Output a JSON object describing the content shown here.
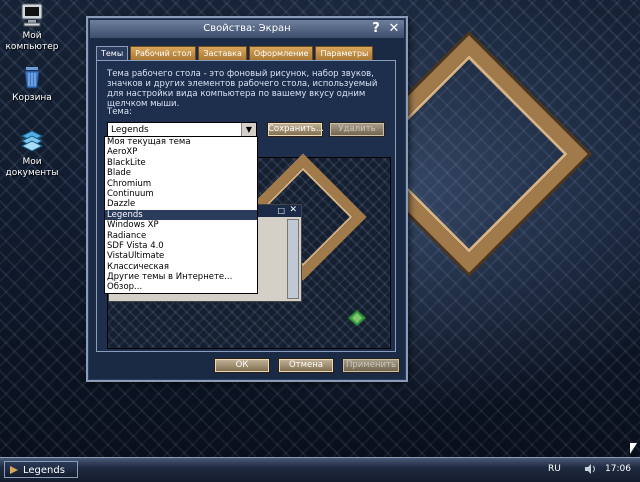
{
  "desktop": {
    "icons": [
      {
        "label": "Мой компьютер",
        "icon": "computer-icon"
      },
      {
        "label": "Корзина",
        "icon": "recycle-bin-icon"
      },
      {
        "label": "Мои документы",
        "icon": "documents-icon"
      }
    ]
  },
  "dialog": {
    "title": "Свойства: Экран",
    "help_glyph": "?",
    "close_glyph": "✕",
    "tabs": [
      "Темы",
      "Рабочий стол",
      "Заставка",
      "Оформление",
      "Параметры"
    ],
    "active_tab": 0,
    "description": "Тема рабочего стола - это фоновый рисунок, набор звуков, значков и других элементов рабочего стола, используемый для настройки вида компьютера по вашему вкусу одним щелчком мыши.",
    "theme_label": "Тема:",
    "theme_value": "Legends",
    "save_button": "Сохранить...",
    "delete_button": "Удалить",
    "ok_button": "ОК",
    "cancel_button": "Отмена",
    "apply_button": "Применить",
    "dropdown_items": [
      "Моя текущая тема",
      "AeroXP",
      "BlackLite",
      "Blade",
      "Chromium",
      "Continuum",
      "Dazzle",
      "Legends",
      "Windows XP",
      "Radiance",
      "SDF Vista 4.0",
      "VistaUltimate",
      "Классическая",
      "Другие темы в Интернете...",
      "Обзор..."
    ],
    "selected_item": "Legends"
  },
  "taskbar": {
    "start_label": "Legends",
    "language": "RU",
    "clock": "17:06"
  },
  "colors": {
    "accent_gold": "#a07a4a",
    "selection": "#2a3b5c"
  }
}
